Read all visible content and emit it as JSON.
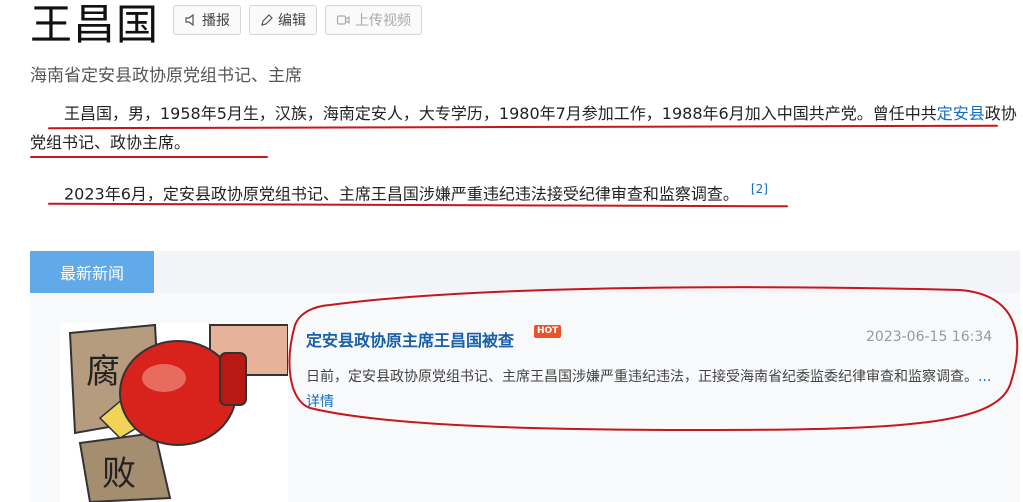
{
  "page": {
    "title": "王昌国",
    "subtitle": "海南省定安县政协原党组书记、主席"
  },
  "toolbar": {
    "broadcast_label": "播报",
    "edit_label": "编辑",
    "upload_label": "上传视频"
  },
  "intro": {
    "para1_text": "王昌国，男，1958年5月生，汉族，海南定安人，大专学历，1980年7月参加工作，1988年6月加入中国共产党。曾任中共",
    "para1_link": "定安县",
    "para1_tail": "政协党组书记、政协主席。",
    "para2_text": "2023年6月，定安县政协原党组书记、主席王昌国涉嫌严重违纪违法接受纪律审查和监察调查。",
    "para2_ref": "[2]"
  },
  "news": {
    "tab_label": "最新新闻",
    "items": [
      {
        "title": "定安县政协原主席王昌国被查",
        "badge": "HOT",
        "date": "2023-06-15 16:34",
        "summary": "日前，定安县政协原党组书记、主席王昌国涉嫌严重违纪违法，正接受海南省纪委监委纪律审查和监察调查。",
        "more": "...详情",
        "image_chars": [
          "腐",
          "败"
        ]
      }
    ]
  },
  "colors": {
    "link": "#136ec2",
    "tab_active": "#61a9e8",
    "annotation_red": "#c8161d",
    "hot": "#e8532c"
  }
}
